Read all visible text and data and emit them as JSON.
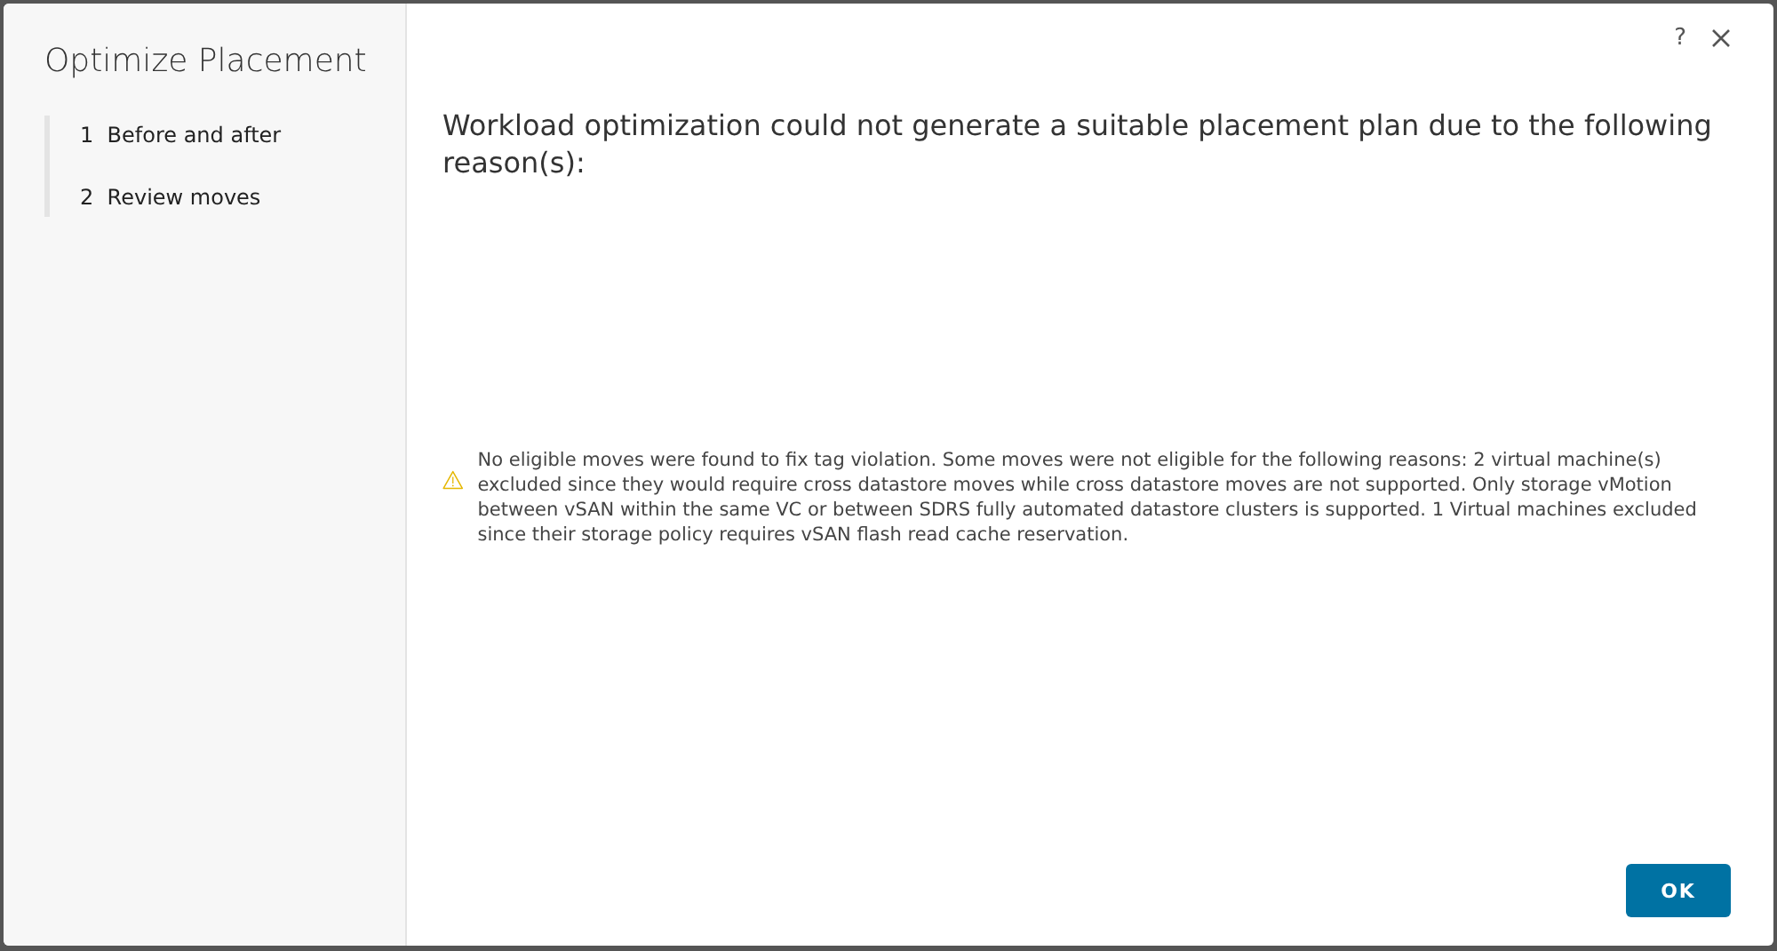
{
  "sidebar": {
    "title": "Optimize Placement",
    "steps": [
      {
        "number": "1",
        "label": "Before and after"
      },
      {
        "number": "2",
        "label": "Review moves"
      }
    ]
  },
  "header": {
    "help": "?"
  },
  "main": {
    "heading": "Workload optimization could not generate a suitable placement plan due to the following reason(s):",
    "warning": "No eligible moves were found to fix tag violation. Some moves were not eligible for the following reasons: 2 virtual machine(s) excluded since they would require cross datastore moves while cross datastore moves are not supported. Only storage vMotion between vSAN within the same VC or between SDRS fully automated datastore clusters is supported. 1 Virtual machines excluded since their storage policy requires vSAN flash read cache reservation."
  },
  "buttons": [
    "OK"
  ]
}
